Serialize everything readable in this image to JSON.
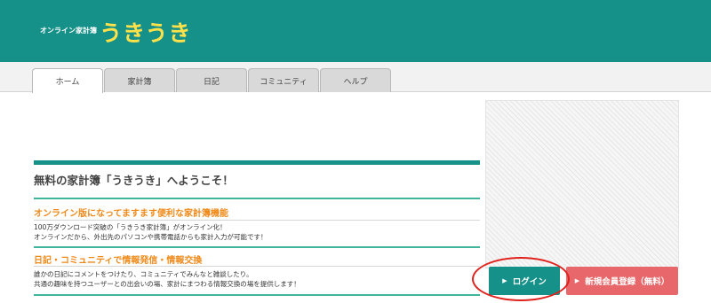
{
  "header": {
    "logo_small": "オンライン家計簿",
    "logo_big": "うきうき"
  },
  "nav": {
    "tabs": [
      {
        "label": "ホーム",
        "active": true
      },
      {
        "label": "家計簿",
        "active": false
      },
      {
        "label": "日記",
        "active": false
      },
      {
        "label": "コミュニティ",
        "active": false
      },
      {
        "label": "ヘルプ",
        "active": false
      }
    ]
  },
  "main": {
    "welcome_title": "無料の家計簿「うきうき」へようこそ！",
    "sections": [
      {
        "title": "オンライン版になってますます便利な家計簿機能",
        "lines": [
          "100万ダウンロード突破の「うきうき家計簿」がオンライン化！",
          "オンラインだから、外出先のパソコンや携帯電話からも家計入力が可能です！"
        ]
      },
      {
        "title": "日記・コミュニティで情報発信・情報交換",
        "lines": [
          "誰かの日記にコメントをつけたり、コミュニティでみんなと雑談したり。",
          "共通の趣味を持つユーザーとの出会いの場、家計にまつわる情報交換の場を提供します！"
        ]
      }
    ]
  },
  "actions": {
    "login_label": "ログイン",
    "register_label": "新規会員登録（無料）",
    "arrow_glyph": "▶"
  },
  "colors": {
    "brand_teal": "#15918a",
    "logo_yellow": "#ffe14a",
    "section_orange": "#ef8a1a",
    "register_red": "#e8676a",
    "highlight_red": "#e0221d"
  }
}
